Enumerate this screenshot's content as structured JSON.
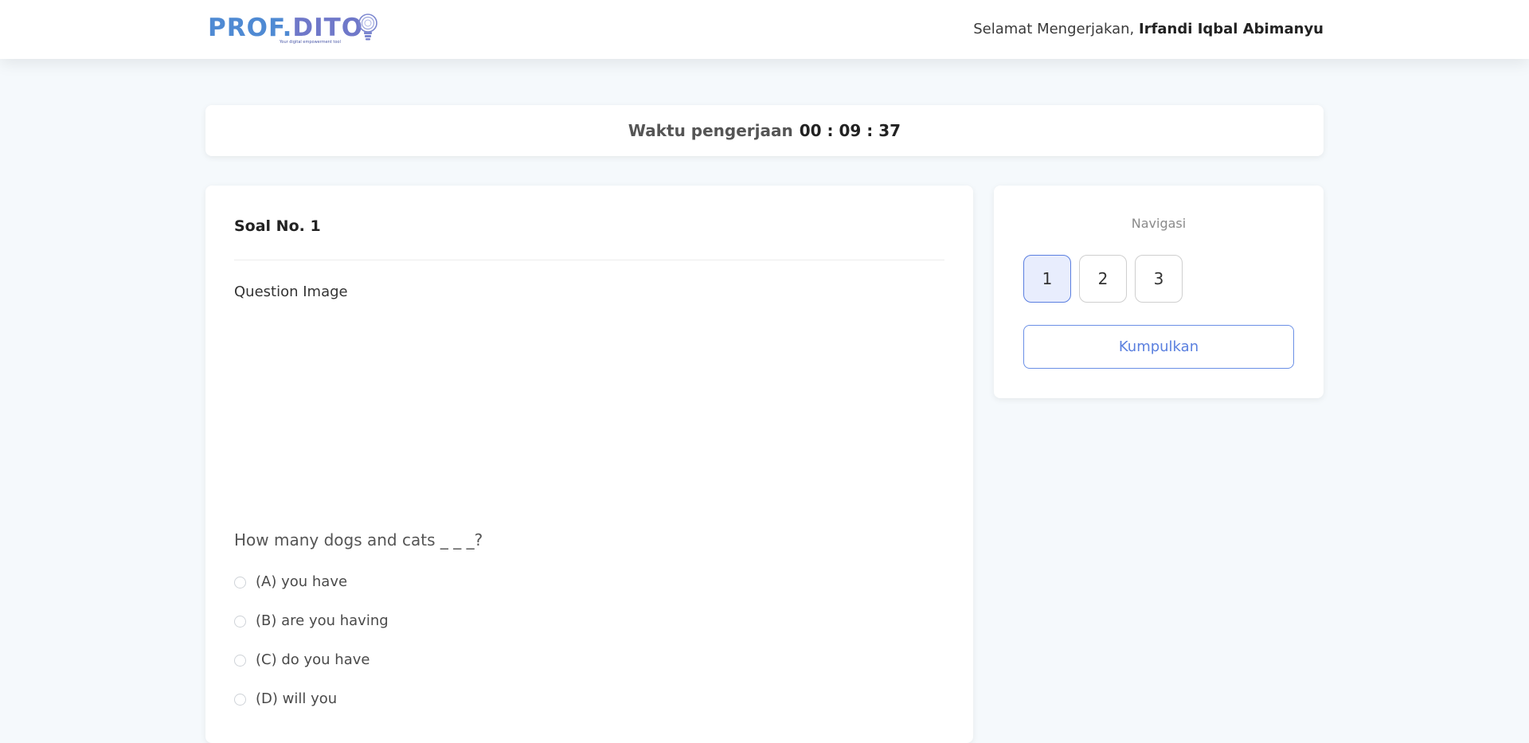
{
  "header": {
    "logo_text_prof": "PROF.",
    "logo_text_dito": "DITO",
    "logo_tagline": "Your digital empowerment tool",
    "greeting_prefix": "Selamat Mengerjakan, ",
    "user_name": "Irfandi Iqbal Abimanyu"
  },
  "timer": {
    "label": "Waktu pengerjaan",
    "value": "00 : 09 : 37"
  },
  "question": {
    "title": "Soal No. 1",
    "image_alt": "Question Image",
    "text": "How many dogs and cats _ _ _?",
    "options": [
      {
        "label": "(A) you have"
      },
      {
        "label": "(B) are you having"
      },
      {
        "label": "(C) do you have"
      },
      {
        "label": "(D) will you"
      }
    ]
  },
  "navigation": {
    "title": "Navigasi",
    "buttons": [
      "1",
      "2",
      "3"
    ],
    "active_index": 0,
    "submit_label": "Kumpulkan"
  },
  "colors": {
    "accent": "#5b80df",
    "active_bg": "#e8edfd",
    "page_bg": "#f5f9fc"
  }
}
